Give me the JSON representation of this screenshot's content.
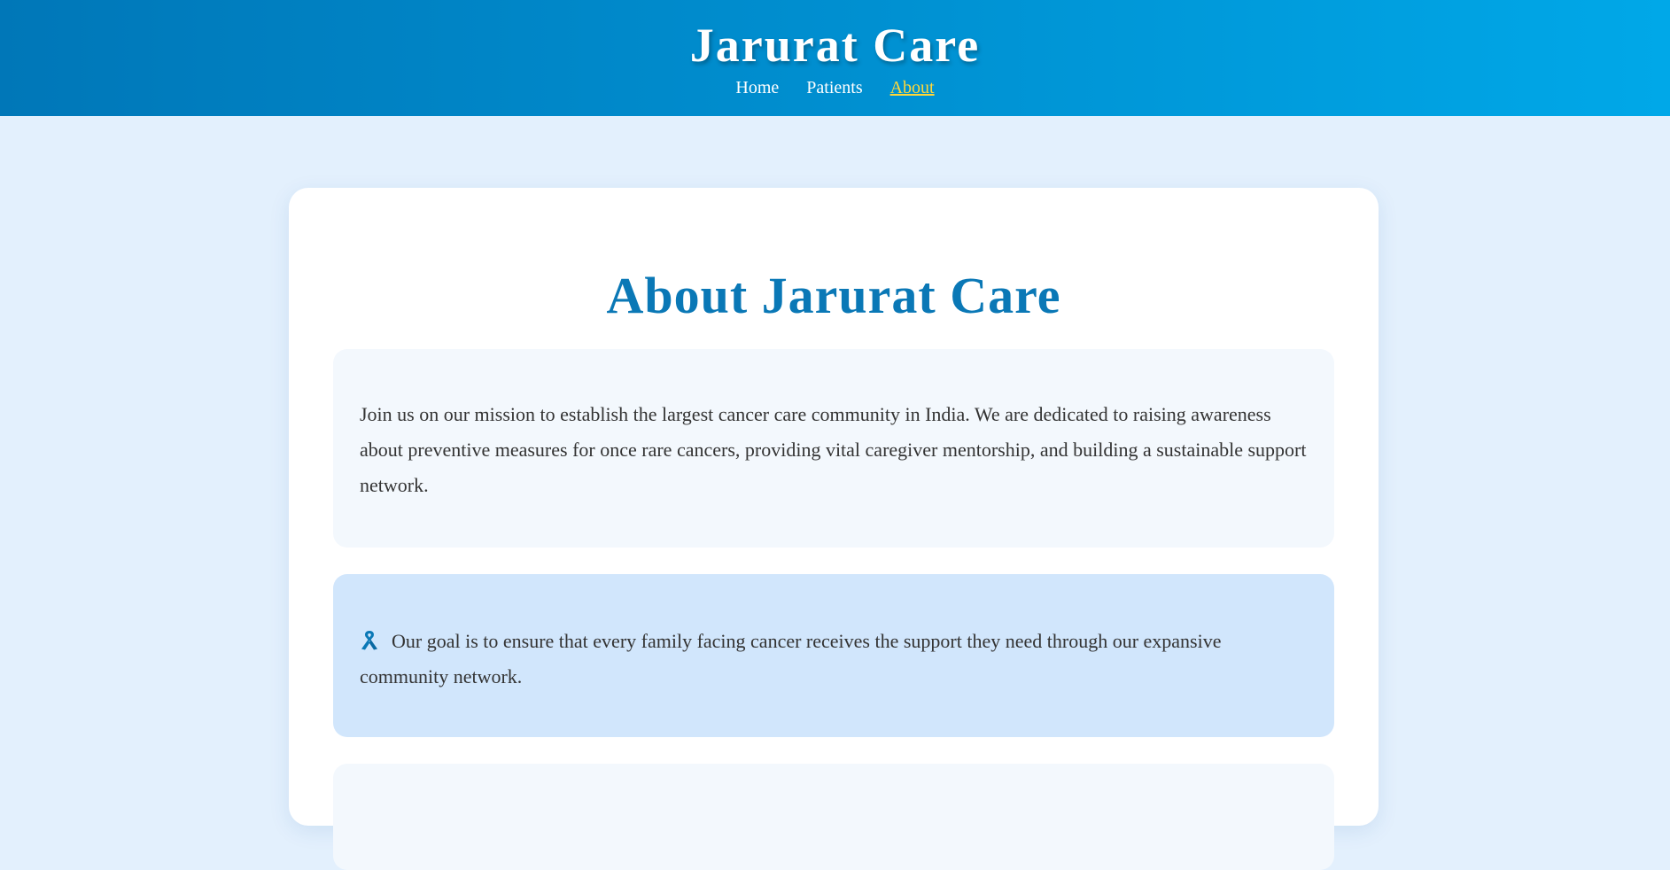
{
  "header": {
    "site_title": "Jarurat Care",
    "nav": {
      "home": "Home",
      "patients": "Patients",
      "about": "About"
    }
  },
  "main": {
    "page_title": "About Jarurat Care",
    "mission_text": "Join us on our mission to establish the largest cancer care community in India. We are dedicated to raising awareness about preventive measures for once rare cancers, providing vital caregiver mentorship, and building a sustainable support network.",
    "goal_text": "Our goal is to ensure that every family facing cancer receives the support they need through our expansive community network.",
    "goal_icon": "ribbon-icon"
  },
  "colors": {
    "header_gradient_start": "#0077b8",
    "header_gradient_end": "#00a8e8",
    "active_nav": "#ffd73a",
    "title_blue": "#0a78b6",
    "page_background": "#e3f0fd",
    "goal_panel": "#d1e6fc"
  }
}
